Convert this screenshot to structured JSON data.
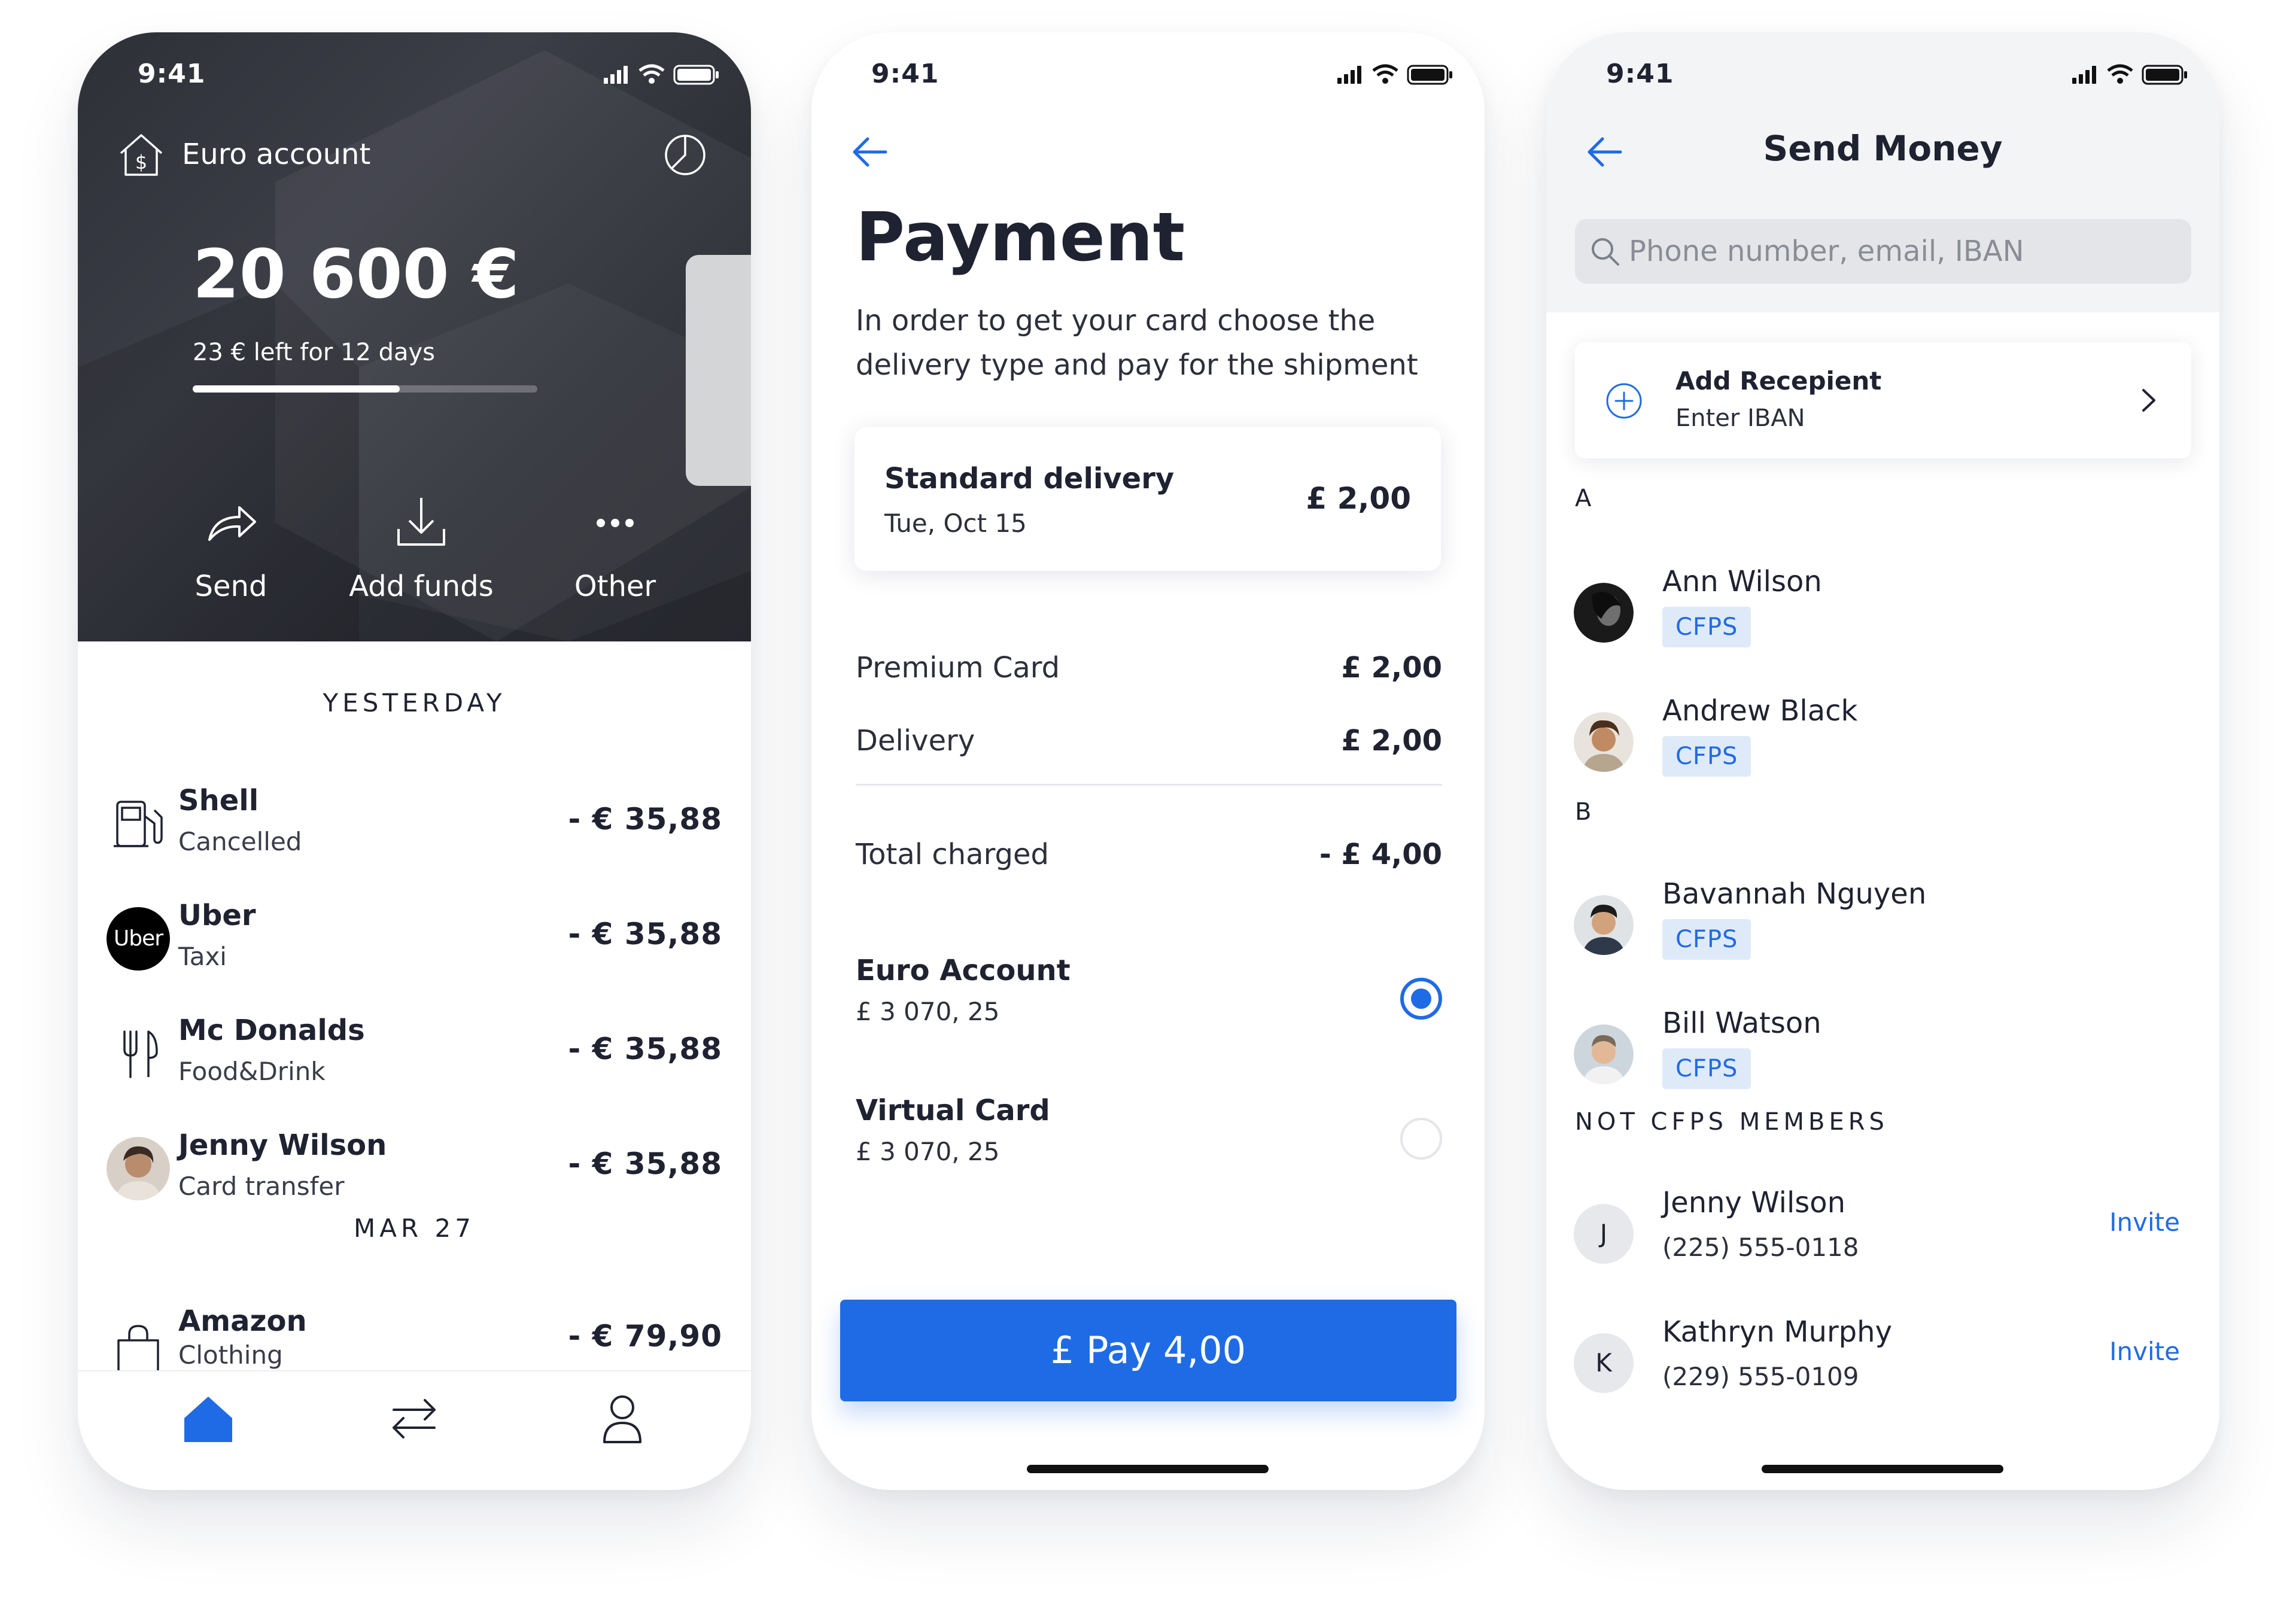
{
  "status_time": "9:41",
  "screens": {
    "account": {
      "account_label": "Euro account",
      "balance": "20 600 €",
      "left_text": "23 € left for 12 days",
      "budget_used_fraction": 0.6,
      "actions": {
        "send": "Send",
        "add_funds": "Add funds",
        "other": "Other"
      },
      "sections": {
        "yesterday": "YESTERDAY",
        "mar27": "MAR 27"
      },
      "transactions": [
        {
          "name": "Shell",
          "sub": "Cancelled",
          "amount": "-  € 35,88",
          "icon": "fuel-icon"
        },
        {
          "name": "Uber",
          "sub": "Taxi",
          "amount": "-  € 35,88",
          "icon": "uber-logo",
          "logo_text": "Uber"
        },
        {
          "name": "Mc Donalds",
          "sub": "Food&Drink",
          "amount": "-  € 35,88",
          "icon": "fork-knife-icon"
        },
        {
          "name": "Jenny Wilson",
          "sub": "Card transfer",
          "amount": "-  € 35,88",
          "icon": "avatar"
        },
        {
          "name": "Amazon",
          "sub": "Clothing",
          "amount": "-  € 79,90",
          "icon": "shopping-bag-icon"
        }
      ],
      "tabs": [
        "home-icon",
        "transfer-icon",
        "profile-icon"
      ],
      "active_tab": "home"
    },
    "payment": {
      "title": "Payment",
      "description": "In order to get your card choose the delivery type and pay for the shipment",
      "delivery": {
        "title": "Standard delivery",
        "date": "Tue, Oct 15",
        "price": "£ 2,00"
      },
      "lines": [
        {
          "label": "Premium Card",
          "value": "£ 2,00"
        },
        {
          "label": "Delivery",
          "value": "£ 2,00"
        }
      ],
      "total": {
        "label": "Total charged",
        "value": "- £ 4,00"
      },
      "accounts": [
        {
          "name": "Euro Account",
          "balance": "£ 3 070, 25",
          "selected": true
        },
        {
          "name": "Virtual Card",
          "balance": "£ 3 070, 25",
          "selected": false
        }
      ],
      "pay_button": "£ Pay 4,00"
    },
    "send_money": {
      "title": "Send Money",
      "search_placeholder": "Phone number, email, IBAN",
      "add_recipient": {
        "title": "Add Recepient",
        "subtitle": "Enter IBAN"
      },
      "letters": {
        "a": "A",
        "b": "B"
      },
      "badge_label": "CFPS",
      "contacts": [
        {
          "name": "Ann Wilson",
          "badge": "CFPS"
        },
        {
          "name": "Andrew Black",
          "badge": "CFPS"
        },
        {
          "name": "Bavannah Nguyen",
          "badge": "CFPS"
        },
        {
          "name": "Bill Watson",
          "badge": "CFPS"
        }
      ],
      "not_members_heading": "NOT CFPS MEMBERS",
      "invitees": [
        {
          "initial": "J",
          "name": "Jenny Wilson",
          "phone": "(225) 555-0118",
          "action": "Invite"
        },
        {
          "initial": "K",
          "name": "Kathryn Murphy",
          "phone": "(229) 555-0109",
          "action": "Invite"
        }
      ]
    }
  },
  "colors": {
    "accent": "#1f6be6",
    "dark_header": "#2e3038",
    "badge_bg": "#dfeaf9"
  }
}
